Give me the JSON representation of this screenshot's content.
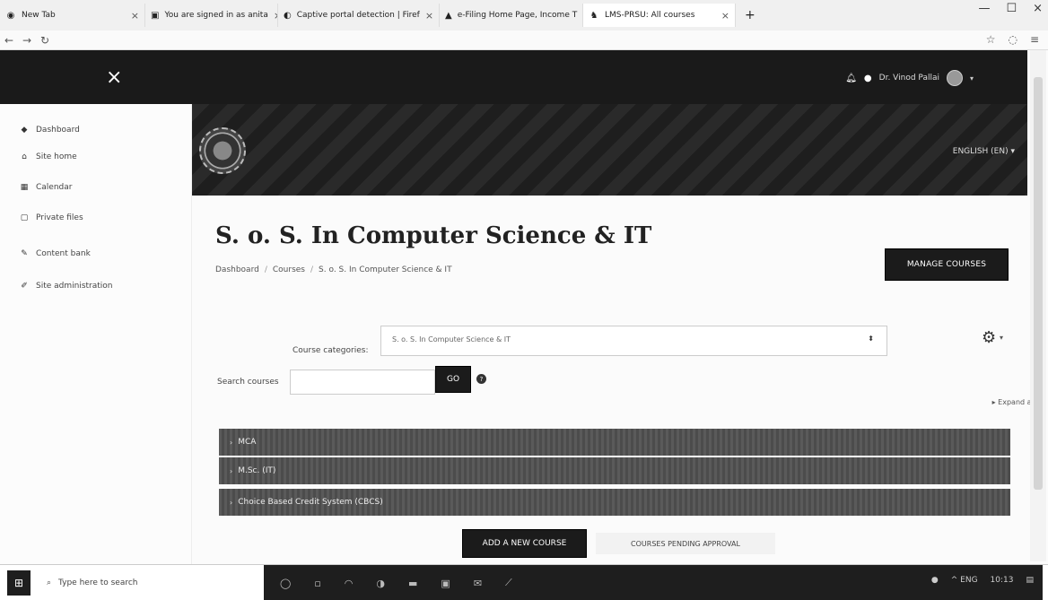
{
  "browser": {
    "tabs": [
      {
        "label": "New Tab",
        "icon": "globe-icon"
      },
      {
        "label": "You are signed in as anita",
        "icon": "shield-icon"
      },
      {
        "label": "Captive portal detection | Firef",
        "icon": "firefox-icon"
      },
      {
        "label": "e-Filing Home Page, Income T",
        "icon": "efiling-icon"
      },
      {
        "label": "LMS-PRSU: All courses",
        "icon": "moodle-icon",
        "active": true
      }
    ],
    "new_tab": "+",
    "close_glyph": "×",
    "window_controls": [
      "—",
      "☐",
      "×"
    ]
  },
  "topbar": {
    "close_drawer": "×",
    "user_name": "Dr. Vinod Pallai",
    "caret": "▾"
  },
  "sidebar": {
    "items": [
      {
        "label": "Dashboard",
        "icon": "dashboard-icon"
      },
      {
        "label": "Site home",
        "icon": "home-icon"
      },
      {
        "label": "Calendar",
        "icon": "calendar-icon"
      },
      {
        "label": "Private files",
        "icon": "file-icon"
      },
      {
        "label": "Content bank",
        "icon": "brush-icon"
      },
      {
        "label": "Site administration",
        "icon": "wrench-icon"
      }
    ]
  },
  "banner": {
    "language": "ENGLISH (EN) ▾"
  },
  "main": {
    "title": "S. o. S. In Computer Science & IT",
    "breadcrumb": [
      "Dashboard",
      "Courses",
      "S. o. S. In Computer Science & IT"
    ],
    "manage_button": "MANAGE COURSES",
    "course_categories_label": "Course categories:",
    "course_categories_value": "S. o. S. In Computer Science & IT",
    "search_label": "Search courses",
    "search_value": "",
    "go_button": "GO",
    "expand_all": "▸ Expand all",
    "categories": [
      "MCA",
      "M.Sc. (IT)",
      "Choice Based Credit System (CBCS)"
    ],
    "add_course_button": "ADD A NEW COURSE",
    "pending_button": "COURSES PENDING APPROVAL"
  },
  "taskbar": {
    "search_placeholder": "Type here to search",
    "tray_text": "^ ENG",
    "time": "10:13"
  }
}
